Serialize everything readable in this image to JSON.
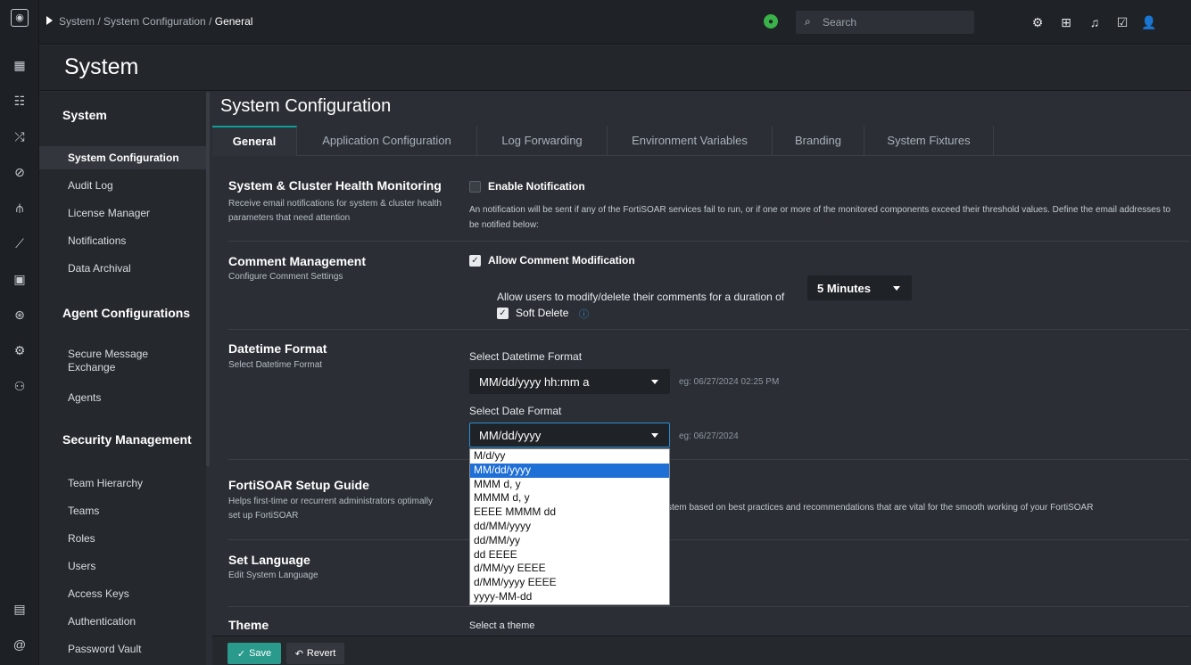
{
  "breadcrumb": {
    "path": "System / System Configuration / ",
    "current": "General"
  },
  "search": {
    "placeholder": "Search"
  },
  "page": {
    "title": "System"
  },
  "sidebar": {
    "sections": [
      {
        "title": "System"
      },
      {
        "title": "Agent Configurations"
      },
      {
        "title": "Security Management"
      }
    ],
    "items": [
      {
        "label": "System Configuration"
      },
      {
        "label": "Audit Log"
      },
      {
        "label": "License Manager"
      },
      {
        "label": "Notifications"
      },
      {
        "label": "Data Archival"
      },
      {
        "label": "Secure Message Exchange"
      },
      {
        "label": "Agents"
      },
      {
        "label": "Team Hierarchy"
      },
      {
        "label": "Teams"
      },
      {
        "label": "Roles"
      },
      {
        "label": "Users"
      },
      {
        "label": "Access Keys"
      },
      {
        "label": "Authentication"
      },
      {
        "label": "Password Vault"
      }
    ]
  },
  "config": {
    "title": "System Configuration",
    "tabs": [
      {
        "label": "General"
      },
      {
        "label": "Application Configuration"
      },
      {
        "label": "Log Forwarding"
      },
      {
        "label": "Environment Variables"
      },
      {
        "label": "Branding"
      },
      {
        "label": "System Fixtures"
      }
    ]
  },
  "health": {
    "title": "System & Cluster Health Monitoring",
    "desc": "Receive email notifications for system & cluster health parameters that need attention",
    "checkbox": "Enable Notification",
    "note": "An notification will be sent if any of the FortiSOAR services fail to run, or if one or more of the monitored components exceed their threshold values. Define the email addresses to be notified below:"
  },
  "comment": {
    "title": "Comment Management",
    "desc": "Configure Comment Settings",
    "checkbox": "Allow Comment Modification",
    "duration_label": "Allow users to modify/delete their comments for a duration of",
    "duration_value": "5 Minutes",
    "soft_delete": "Soft Delete"
  },
  "datetime": {
    "title": "Datetime Format",
    "desc": "Select Datetime Format",
    "datetime_label": "Select Datetime Format",
    "datetime_value": "MM/dd/yyyy hh:mm a",
    "datetime_example": "eg: 06/27/2024 02:25 PM",
    "date_label": "Select Date Format",
    "date_value": "MM/dd/yyyy",
    "date_example": "eg: 06/27/2024",
    "options": [
      "M/d/yy",
      "MM/dd/yyyy",
      "MMM d, y",
      "MMMM d, y",
      "EEEE MMMM dd",
      "dd/MM/yyyy",
      "dd/MM/yy",
      "dd EEEE",
      "d/MM/yy EEEE",
      "d/MM/yyyy EEEE",
      "yyyy-MM-dd"
    ]
  },
  "setup": {
    "title": "FortiSOAR Setup Guide",
    "desc": "Helps first-time or recurrent administrators optimally set up FortiSOAR",
    "note": "ystem based on best practices and recommendations that are vital for the smooth working of your FortiSOAR"
  },
  "language": {
    "title": "Set Language",
    "desc": "Edit System Language"
  },
  "theme": {
    "title": "Theme",
    "label": "Select a theme"
  },
  "actions": {
    "save": "Save",
    "revert": "Revert"
  }
}
